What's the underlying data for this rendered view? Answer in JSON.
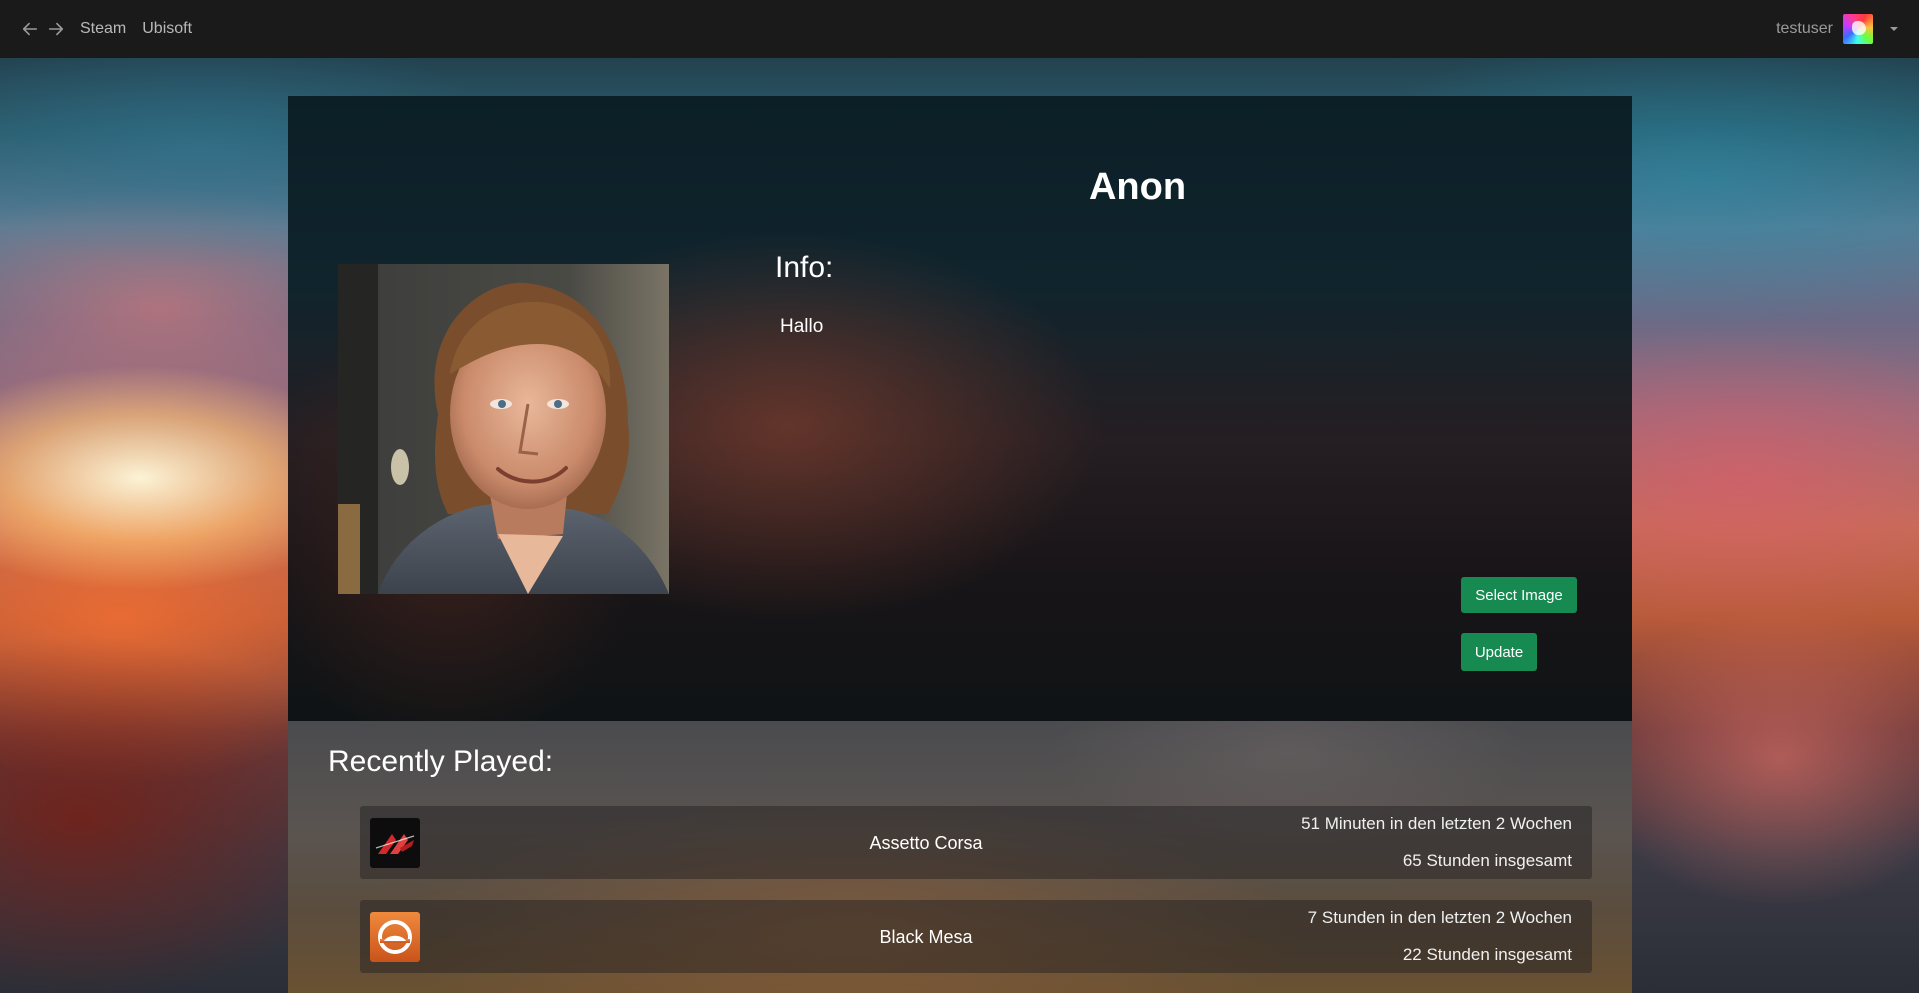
{
  "nav": {
    "links": [
      "Steam",
      "Ubisoft"
    ],
    "username": "testuser"
  },
  "profile": {
    "name": "Anon",
    "info_label": "Info:",
    "info_text": "Hallo",
    "select_image_label": "Select Image",
    "update_label": "Update"
  },
  "recent": {
    "title": "Recently Played:",
    "games": [
      {
        "name": "Assetto Corsa",
        "recent": "51 Minuten in den letzten 2 Wochen",
        "total": "65 Stunden insgesamt",
        "icon": "assetto-corsa-logo"
      },
      {
        "name": "Black Mesa",
        "recent": "7 Stunden in den letzten 2 Wochen",
        "total": "22 Stunden insgesamt",
        "icon": "black-mesa-logo"
      }
    ]
  },
  "colors": {
    "accent_button": "#178a52",
    "topbar": "#1a1a1a"
  }
}
